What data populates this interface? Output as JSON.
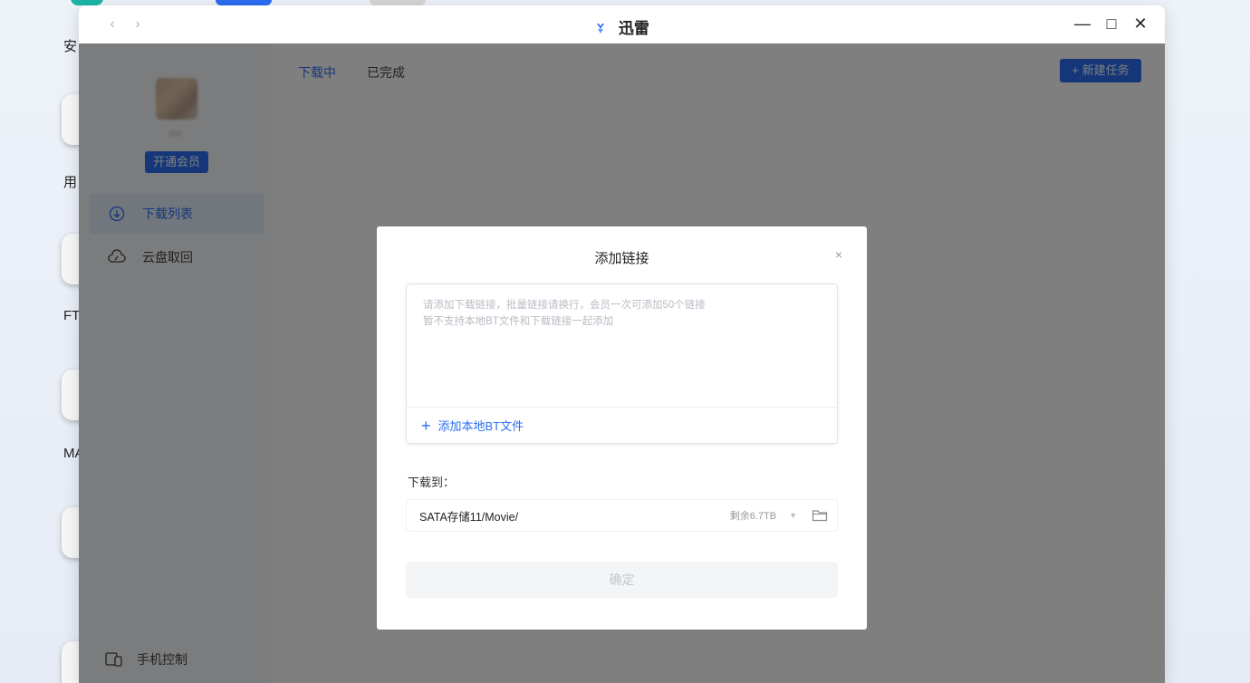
{
  "desktop": {
    "labels": [
      "安",
      "用",
      "FT",
      "MA"
    ]
  },
  "window": {
    "title": "迅雷",
    "nav": {
      "back": "‹",
      "forward": "›"
    },
    "controls": {
      "minimize": "—",
      "maximize": "□",
      "close": "✕"
    }
  },
  "sidebar": {
    "username": "xxx",
    "vip_button": "开通会员",
    "items": [
      {
        "label": "下载列表",
        "icon": "download-circle-icon",
        "active": true
      },
      {
        "label": "云盘取回",
        "icon": "cloud-icon",
        "active": false
      }
    ],
    "bottom": {
      "label": "手机控制",
      "icon": "phone-laptop-icon"
    }
  },
  "main": {
    "tabs": [
      {
        "label": "下载中",
        "active": true
      },
      {
        "label": "已完成",
        "active": false
      }
    ],
    "new_task_button": "+ 新建任务"
  },
  "modal": {
    "title": "添加链接",
    "close": "×",
    "link_input": {
      "value": "",
      "placeholder": "请添加下载链接，批量链接请换行，会员一次可添加50个链接\n暂不支持本地BT文件和下载链接一起添加"
    },
    "add_bt": {
      "plus": "+",
      "label": "添加本地BT文件"
    },
    "save_to_label": "下载到：",
    "save_path": {
      "path": "SATA存储11/Movie/",
      "free_space": "剩余6.7TB",
      "caret": "▼"
    },
    "confirm_button": "确定"
  },
  "colors": {
    "accent": "#2b6ef2",
    "overlay": "rgba(0,0,0,0.50)",
    "sidebar_bg": "#f7f8fa"
  }
}
